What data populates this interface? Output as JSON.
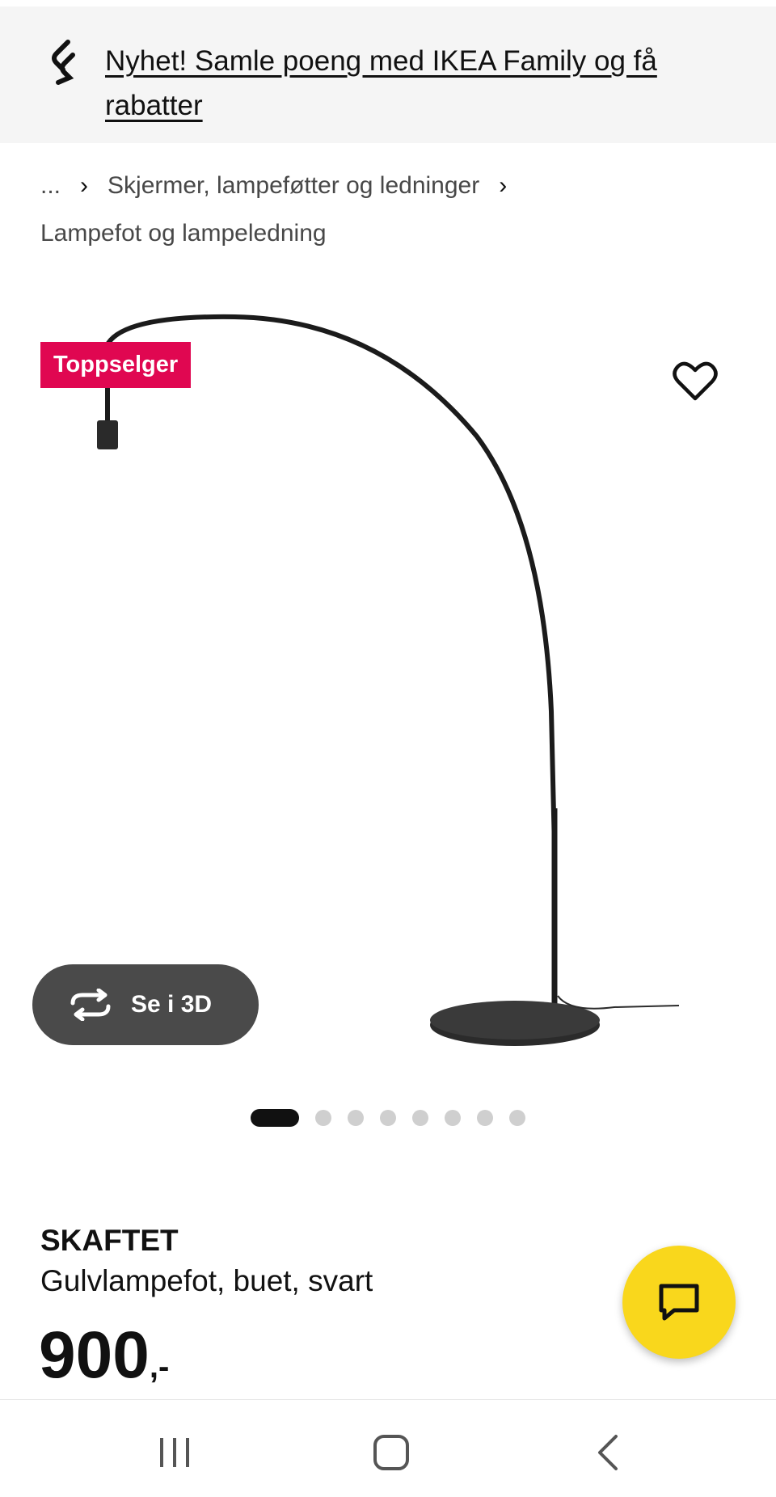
{
  "promo": {
    "text": "Nyhet! Samle poeng med IKEA Family og få rabatter",
    "icon": "ikea-family-icon"
  },
  "breadcrumb": {
    "ellipsis": "...",
    "item1": "Skjermer, lampeføtter og ledninger",
    "item2": "Lampefot og lampeledning"
  },
  "product": {
    "badge": "Toppselger",
    "view3d_label": "Se i 3D",
    "gallery_image_count": 8,
    "gallery_active_index": 0,
    "name": "SKAFTET",
    "description": "Gulvlampefot, buet, svart",
    "price_integer": "900",
    "price_suffix": ",-"
  },
  "colors": {
    "badge": "#e00751",
    "chat": "#f9d71c",
    "promo_bg": "#f5f5f5",
    "button_3d": "#4a4a4a"
  }
}
